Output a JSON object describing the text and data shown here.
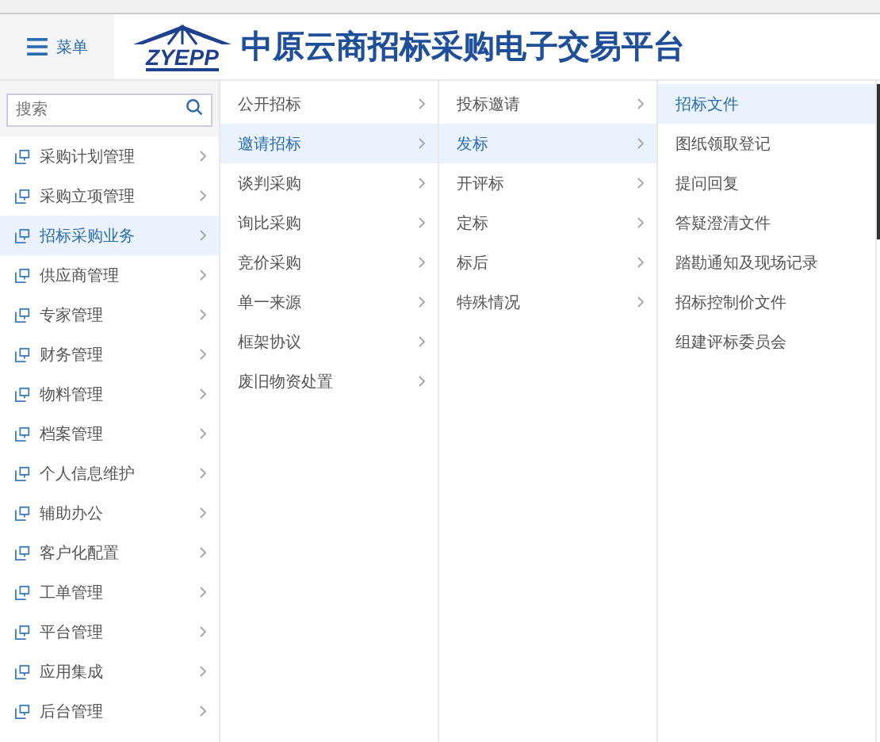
{
  "header": {
    "menu_button": "菜单",
    "logo": "ZYEPP",
    "title": "中原云商招标采购电子交易平台"
  },
  "search": {
    "placeholder": "搜索"
  },
  "menu": [
    {
      "label": "采购计划管理",
      "selected": false
    },
    {
      "label": "采购立项管理",
      "selected": false
    },
    {
      "label": "招标采购业务",
      "selected": true
    },
    {
      "label": "供应商管理",
      "selected": false
    },
    {
      "label": "专家管理",
      "selected": false
    },
    {
      "label": "财务管理",
      "selected": false
    },
    {
      "label": "物料管理",
      "selected": false
    },
    {
      "label": "档案管理",
      "selected": false
    },
    {
      "label": "个人信息维护",
      "selected": false
    },
    {
      "label": "辅助办公",
      "selected": false
    },
    {
      "label": "客户化配置",
      "selected": false
    },
    {
      "label": "工单管理",
      "selected": false
    },
    {
      "label": "平台管理",
      "selected": false
    },
    {
      "label": "应用集成",
      "selected": false
    },
    {
      "label": "后台管理",
      "selected": false
    }
  ],
  "submenu": [
    {
      "label": "公开招标",
      "selected": false
    },
    {
      "label": "邀请招标",
      "selected": true
    },
    {
      "label": "谈判采购",
      "selected": false
    },
    {
      "label": "询比采购",
      "selected": false
    },
    {
      "label": "竞价采购",
      "selected": false
    },
    {
      "label": "单一来源",
      "selected": false
    },
    {
      "label": "框架协议",
      "selected": false
    },
    {
      "label": "废旧物资处置",
      "selected": false
    }
  ],
  "submenu_2": [
    {
      "label": "投标邀请",
      "selected": false
    },
    {
      "label": "发标",
      "selected": true
    },
    {
      "label": "开评标",
      "selected": false
    },
    {
      "label": "定标",
      "selected": false
    },
    {
      "label": "标后",
      "selected": false
    },
    {
      "label": "特殊情况",
      "selected": false
    }
  ],
  "submenu_3": [
    {
      "label": "招标文件",
      "selected": true
    },
    {
      "label": "图纸领取登记",
      "selected": false
    },
    {
      "label": "提问回复",
      "selected": false
    },
    {
      "label": "答疑澄清文件",
      "selected": false
    },
    {
      "label": "踏勘通知及现场记录",
      "selected": false
    },
    {
      "label": "招标控制价文件",
      "selected": false
    },
    {
      "label": "组建评标委员会",
      "selected": false
    }
  ]
}
